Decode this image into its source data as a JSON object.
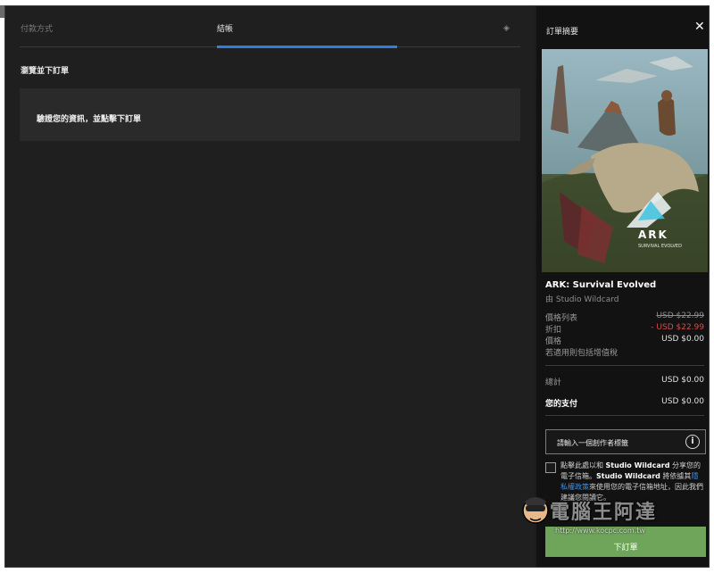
{
  "tabs": {
    "payment_label": "付款方式",
    "checkout_label": "結帳"
  },
  "main": {
    "section_title": "瀏覽並下訂單",
    "verify_text": "驗證您的資訊，並點擊下訂單"
  },
  "sidebar": {
    "title": "訂單摘要",
    "product": {
      "name": "ARK: Survival Evolved",
      "by": "由 Studio Wildcard",
      "logo_text": "ARK",
      "logo_sub": "SURVIVAL EVOLVED"
    },
    "prices": {
      "list_label": "價格列表",
      "list_value": "USD $22.99",
      "discount_label": "折扣",
      "discount_value": "- USD $22.99",
      "price_label": "價格",
      "price_value": "USD $0.00",
      "tax_note": "若適用則包括增值稅",
      "total_label": "總計",
      "total_value": "USD $0.00",
      "pay_label": "您的支付",
      "pay_value": "USD $0.00"
    },
    "creator_placeholder": "請輸入一個創作者標籤",
    "consent": {
      "part1": "點擊此處以和 ",
      "brand1": "Studio Wildcard",
      "part2": " 分享您的電子信箱。",
      "brand2": "Studio Wildcard",
      "part3": " 將依據其",
      "link": "隱私權政策",
      "part4": "來使用您的電子信箱地址，因此我們建議您閱讀它。"
    },
    "order_button": "下訂單"
  },
  "watermark": {
    "text": "電腦王阿達",
    "url": "http://www.kocpc.com.tw"
  },
  "colors": {
    "accent": "#2a7fe0",
    "order_button": "#6fa55a",
    "discount": "#d05050",
    "link": "#3a8fe8"
  }
}
